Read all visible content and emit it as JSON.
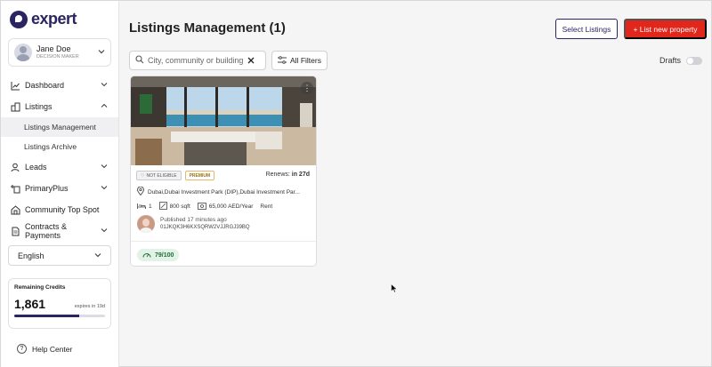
{
  "brand": {
    "logo_text": "expert",
    "color": "#2a2560"
  },
  "user": {
    "name": "Jane Doe",
    "role": "DECISION MAKER"
  },
  "nav": {
    "dashboard": "Dashboard",
    "listings": "Listings",
    "listings_management": "Listings Management",
    "listings_archive": "Listings Archive",
    "leads": "Leads",
    "primary_plus": "PrimaryPlus",
    "community_top_spot": "Community Top Spot",
    "contracts_payments": "Contracts & Payments"
  },
  "language": {
    "selected": "English"
  },
  "credits": {
    "title": "Remaining Credits",
    "value": "1,861",
    "expires": "expires in 19d",
    "progress_fraction": 0.72
  },
  "help": {
    "label": "Help Center"
  },
  "page": {
    "title": "Listings Management (1)"
  },
  "toolbar": {
    "select_listings": "Select Listings",
    "list_new_property": "+ List new property",
    "search_placeholder": "City, community or building",
    "all_filters": "All Filters",
    "drafts_label": "Drafts",
    "accent_color": "#e1261c"
  },
  "listing": {
    "badge_not_eligible": "NOT ELIGIBLE",
    "badge_premium": "PREMIUM",
    "renews_label": "Renews:",
    "renews_value": "in 27d",
    "location": "Dubai,Dubai Investment Park (DIP),Dubai Investment Par...",
    "bedrooms": "1",
    "area": "800 sqft",
    "price": "65,000 AED/Year",
    "type": "Rent",
    "published": "Published 17 minutes ago",
    "reference": "01JKQK3H6KXSQRW2VJJRGJ39BQ",
    "score": "79/100"
  }
}
